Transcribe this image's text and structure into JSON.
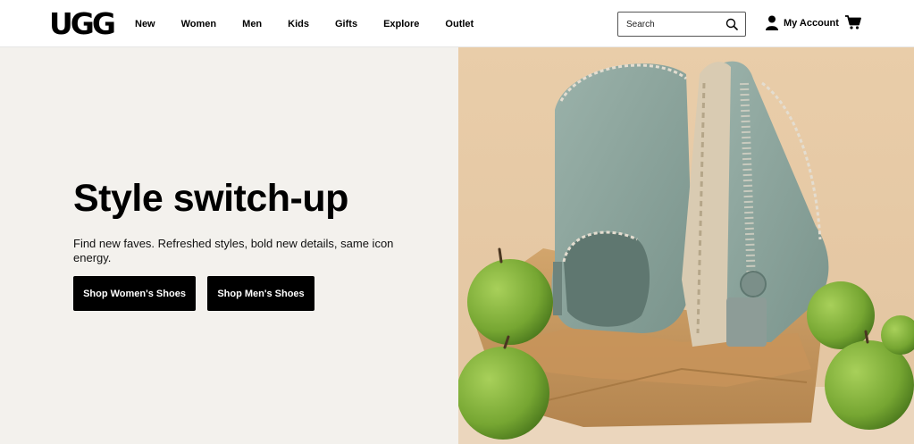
{
  "brand": {
    "logo": "UGG"
  },
  "nav": {
    "items": [
      {
        "label": "New"
      },
      {
        "label": "Women"
      },
      {
        "label": "Men"
      },
      {
        "label": "Kids"
      },
      {
        "label": "Gifts"
      },
      {
        "label": "Explore"
      },
      {
        "label": "Outlet"
      }
    ]
  },
  "search": {
    "placeholder": "Search",
    "icon": "search-icon"
  },
  "account": {
    "label": "My Account",
    "icon": "user-icon"
  },
  "cart": {
    "icon": "cart-icon"
  },
  "hero": {
    "title": "Style switch-up",
    "subtitle": "Find new faves. Refreshed styles, bold new details, same icon energy.",
    "buttons": {
      "women": "Shop Women's Shoes",
      "men": "Shop Men's Shoes"
    },
    "image": "sage-green-slipper-clogs-with-apples-in-paper-bag"
  },
  "colors": {
    "hero_bg": "#f3f1ed",
    "button_bg": "#000000",
    "photo_bg": "#e8c9a6",
    "shoe": "#8aa39b",
    "apple": "#7fae3a",
    "paper_bag": "#c79a62"
  }
}
